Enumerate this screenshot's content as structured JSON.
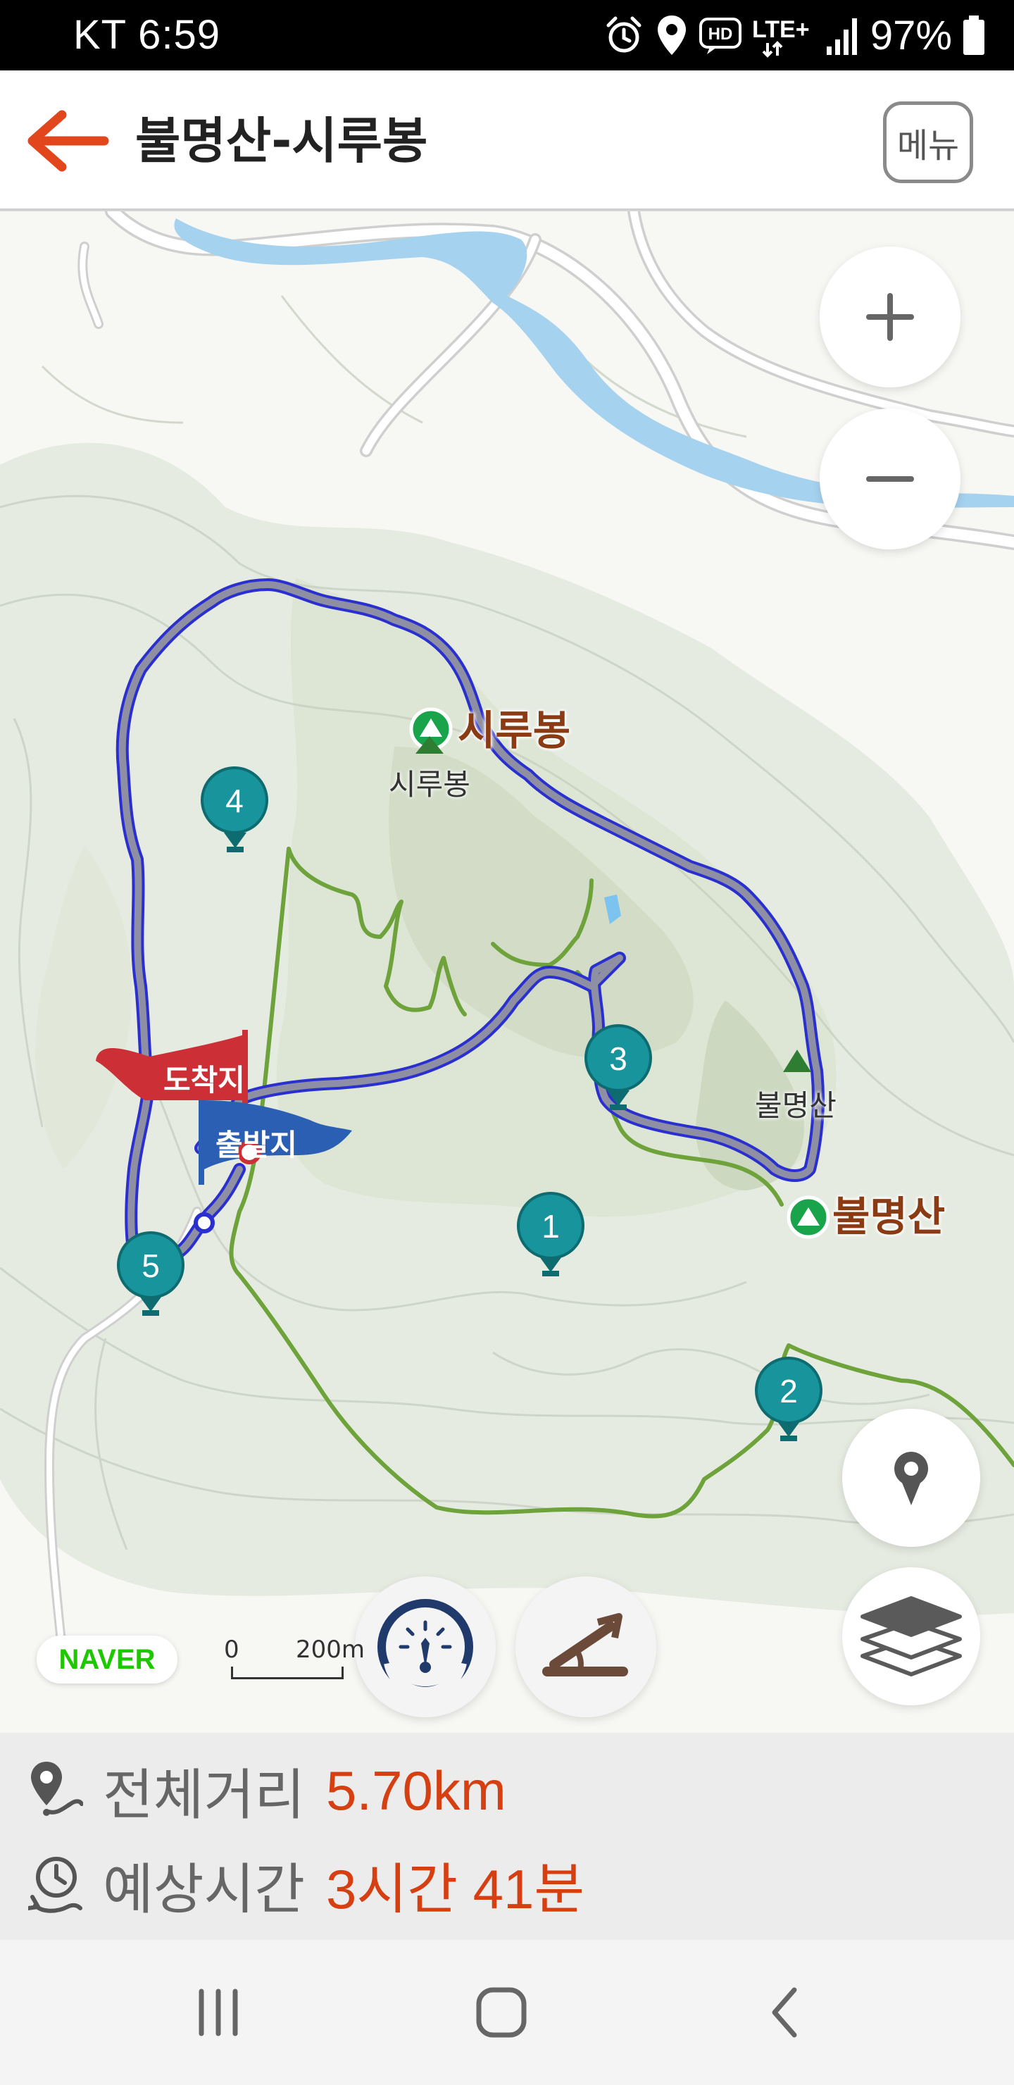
{
  "status_bar": {
    "carrier_time": "KT 6:59",
    "battery": "97%",
    "icons": [
      "alarm-icon",
      "location-pin-icon",
      "hd-voice-icon",
      "lte-plus-icon",
      "signal-icon",
      "battery-icon"
    ],
    "hd_text": "HD",
    "lte_text": "LTE+"
  },
  "header": {
    "title": "불명산-시루봉",
    "menu_label": "메뉴",
    "back_icon": "back-arrow-icon",
    "accent_color": "#e2461c"
  },
  "map": {
    "peaks": [
      {
        "label": "시루봉",
        "sublabel": "시루봉"
      },
      {
        "label": "불명산",
        "sublabel": "불명산"
      }
    ],
    "waypoints": [
      "1",
      "2",
      "3",
      "4",
      "5"
    ],
    "flags": {
      "start": "출발지",
      "end": "도착지"
    },
    "provider": "NAVER",
    "scale": {
      "zero": "0",
      "value": "200m"
    },
    "colors": {
      "route": "#8e8fa3",
      "route_outline": "#2a2fd0",
      "trail": "#6ea33c",
      "marker": "#17949c",
      "water": "#a5d2ef"
    },
    "controls": [
      "zoom-in-icon",
      "zoom-out-icon",
      "my-location-icon",
      "layers-icon",
      "speedometer-icon",
      "slope-icon"
    ]
  },
  "info": {
    "distance_label": "전체거리",
    "distance_value": "5.70km",
    "time_label": "예상시간",
    "time_value": "3시간 41분"
  },
  "nav_bar": {
    "icons": [
      "recent-apps-icon",
      "home-icon",
      "back-icon"
    ]
  }
}
